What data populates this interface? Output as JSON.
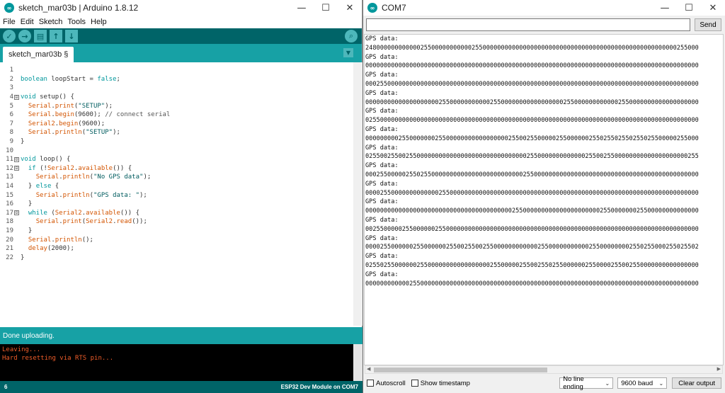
{
  "ide": {
    "title": "sketch_mar03b | Arduino 1.8.12",
    "window_controls": {
      "minimize": "—",
      "maximize": "☐",
      "close": "✕"
    },
    "menu": [
      "File",
      "Edit",
      "Sketch",
      "Tools",
      "Help"
    ],
    "tab": {
      "label": "sketch_mar03b §"
    },
    "status_message": "Done uploading.",
    "console_lines": [
      "Leaving...",
      "Hard resetting via RTS pin..."
    ],
    "bottom_line_number": "6",
    "board_info": "ESP32 Dev Module on COM7",
    "code_lines": [
      {
        "n": "1",
        "fold": "",
        "text": ""
      },
      {
        "n": "2",
        "fold": "",
        "text": "boolean loopStart = false;"
      },
      {
        "n": "3",
        "fold": "",
        "text": ""
      },
      {
        "n": "4",
        "fold": "⊟",
        "text": "void setup() {"
      },
      {
        "n": "5",
        "fold": "",
        "text": "  Serial.print(\"SETUP\");"
      },
      {
        "n": "6",
        "fold": "",
        "text": "  Serial.begin(9600); // connect serial"
      },
      {
        "n": "7",
        "fold": "",
        "text": "  Serial2.begin(9600);"
      },
      {
        "n": "8",
        "fold": "",
        "text": "  Serial.println(\"SETUP\");"
      },
      {
        "n": "9",
        "fold": "",
        "text": "}"
      },
      {
        "n": "10",
        "fold": "",
        "text": ""
      },
      {
        "n": "11",
        "fold": "⊟",
        "text": "void loop() {"
      },
      {
        "n": "12",
        "fold": "⊟",
        "text": "  if (!Serial2.available()) {"
      },
      {
        "n": "13",
        "fold": "",
        "text": "    Serial.println(\"No GPS data\");"
      },
      {
        "n": "14",
        "fold": "",
        "text": "  } else {"
      },
      {
        "n": "15",
        "fold": "",
        "text": "    Serial.println(\"GPS data: \");"
      },
      {
        "n": "16",
        "fold": "",
        "text": "  }"
      },
      {
        "n": "17",
        "fold": "⊟",
        "text": "  while (Serial2.available()) {"
      },
      {
        "n": "18",
        "fold": "",
        "text": "    Serial.print(Serial2.read());"
      },
      {
        "n": "19",
        "fold": "",
        "text": "  }"
      },
      {
        "n": "20",
        "fold": "",
        "text": "  Serial.println();"
      },
      {
        "n": "21",
        "fold": "",
        "text": "  delay(2000);"
      },
      {
        "n": "22",
        "fold": "",
        "text": "}"
      }
    ]
  },
  "serial": {
    "title": "COM7",
    "window_controls": {
      "minimize": "—",
      "maximize": "☐",
      "close": "✕"
    },
    "input_value": "",
    "send_label": "Send",
    "autoscroll_label": "Autoscroll",
    "timestamp_label": "Show timestamp",
    "line_ending": "No line ending",
    "baud": "9600 baud",
    "clear_label": "Clear output",
    "output_lines": [
      "GPS data:",
      "2480000000000002550000000000025500000000000000000000000000000000000000000000000000000255000",
      "GPS data:",
      "0000000000000000000000000000000000000000000000000000000000000000000000000000000000000000000",
      "GPS data:",
      "0002550000000000000000000000000000000000000000000000000000000000000000000000000000000000000",
      "GPS data:",
      "0000000000000000000025500000000000255000000000000000002550000000000002550000000000000000000",
      "GPS data:",
      "0255000000000000000000000000000000000000000000000000000000000000000000000000000000000000000",
      "GPS data:",
      "0000000002550000000255000000000000000002550025500000255000000255025502550255025500000255000",
      "GPS data:",
      "0255002550025500000000000000000000000000000025500000000000002550025500000000000000000000255",
      "GPS data:",
      "0002550000025502550000000000000000000000000255000000000000000000000000000000000000000000000",
      "GPS data:",
      "0000255000000000000025500000000000000000000000000000000000000000000000000000000000000000000",
      "GPS data:",
      "0000000000000000000000000000000000000000255000000000000000000000255000000025500000000000000",
      "GPS data:",
      "0025500000255000000255000000000000000000000000000000000000000000000000000000000000000000000",
      "GPS data:",
      "0000255000000255000000255002550025500000000000025500000000000255000000002550255000255025502",
      "GPS data:",
      "0255025500000025500000000000000000255000002550025502550000002550000255002550000000000000000",
      "GPS data:",
      "0000000000002550000000000000000000000000000000000000000000000000000000000000000000000000000"
    ]
  }
}
